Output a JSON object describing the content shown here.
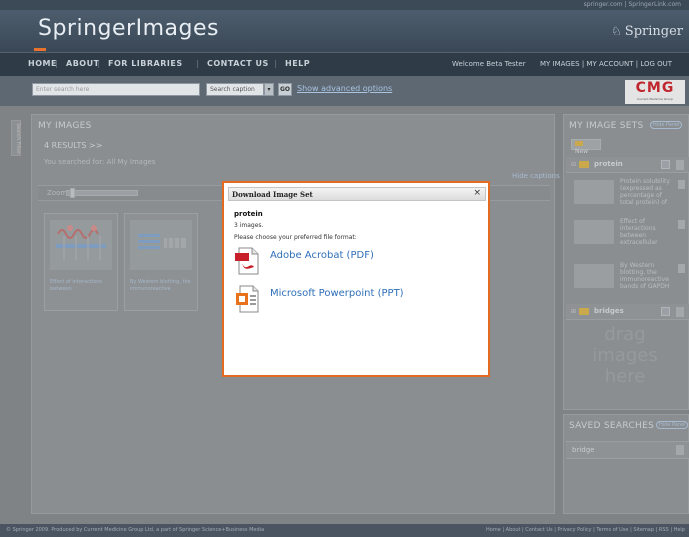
{
  "topbar": {
    "links": "springer.com | SpringerLink.com"
  },
  "header": {
    "logo": "SpringerImages",
    "publisher": "Springer"
  },
  "nav": {
    "items": [
      "HOME",
      "ABOUT",
      "FOR LIBRARIES",
      "CONTACT US",
      "HELP"
    ],
    "welcome": "Welcome Beta Tester",
    "user_links": "MY IMAGES | MY ACCOUNT | LOG OUT"
  },
  "search": {
    "placeholder": "Enter search here",
    "scope": "Search caption",
    "go": "GO",
    "advanced_link": "Show advanced options"
  },
  "sponsor": {
    "logo": "CMG",
    "sub": "Current Medicine Group"
  },
  "sidetab": {
    "label": "Search Filter"
  },
  "main": {
    "title": "MY IMAGES",
    "results": "4 RESULTS >>",
    "searched_for": "You searched for: All My Images",
    "hide_captions": "Hide captions",
    "zoom_label": "Zoom:",
    "thumbnails": [
      {
        "caption": "Effect of interactions between"
      },
      {
        "caption": "By Western blotting, the immunoreactive"
      }
    ]
  },
  "image_sets": {
    "title": "MY IMAGE SETS",
    "hide": "Hide Panel",
    "new_label": "New",
    "sets": [
      {
        "name": "protein"
      },
      {
        "name": "bridges"
      }
    ],
    "items": [
      {
        "text": "Protein solubility (expressed as percentage of total protein) of"
      },
      {
        "text": "Effect of interactions between extracellular"
      },
      {
        "text": "By Western blotting, the immunoreactive bands of GAPDH"
      }
    ],
    "drag_hint": "drag images here"
  },
  "saved_searches": {
    "title": "SAVED SEARCHES",
    "hide": "Hide Panel",
    "items": [
      {
        "name": "bridge"
      }
    ]
  },
  "footer": {
    "left": "© Springer 2009. Produced by Current Medicine Group Ltd, a part of Springer Science+Business Media",
    "right": "Home | About | Contact Us | Privacy Policy | Terms of Use | Sitemap | RSS | Help"
  },
  "dialog": {
    "title": "Download Image Set",
    "close": "×",
    "set_name": "protein",
    "count": "3 images.",
    "prompt": "Please choose your preferred file format:",
    "formats": [
      {
        "label": "Adobe Acrobat (PDF)",
        "icon": "pdf-file-icon"
      },
      {
        "label": "Microsoft Powerpoint (PPT)",
        "icon": "ppt-file-icon"
      }
    ]
  }
}
